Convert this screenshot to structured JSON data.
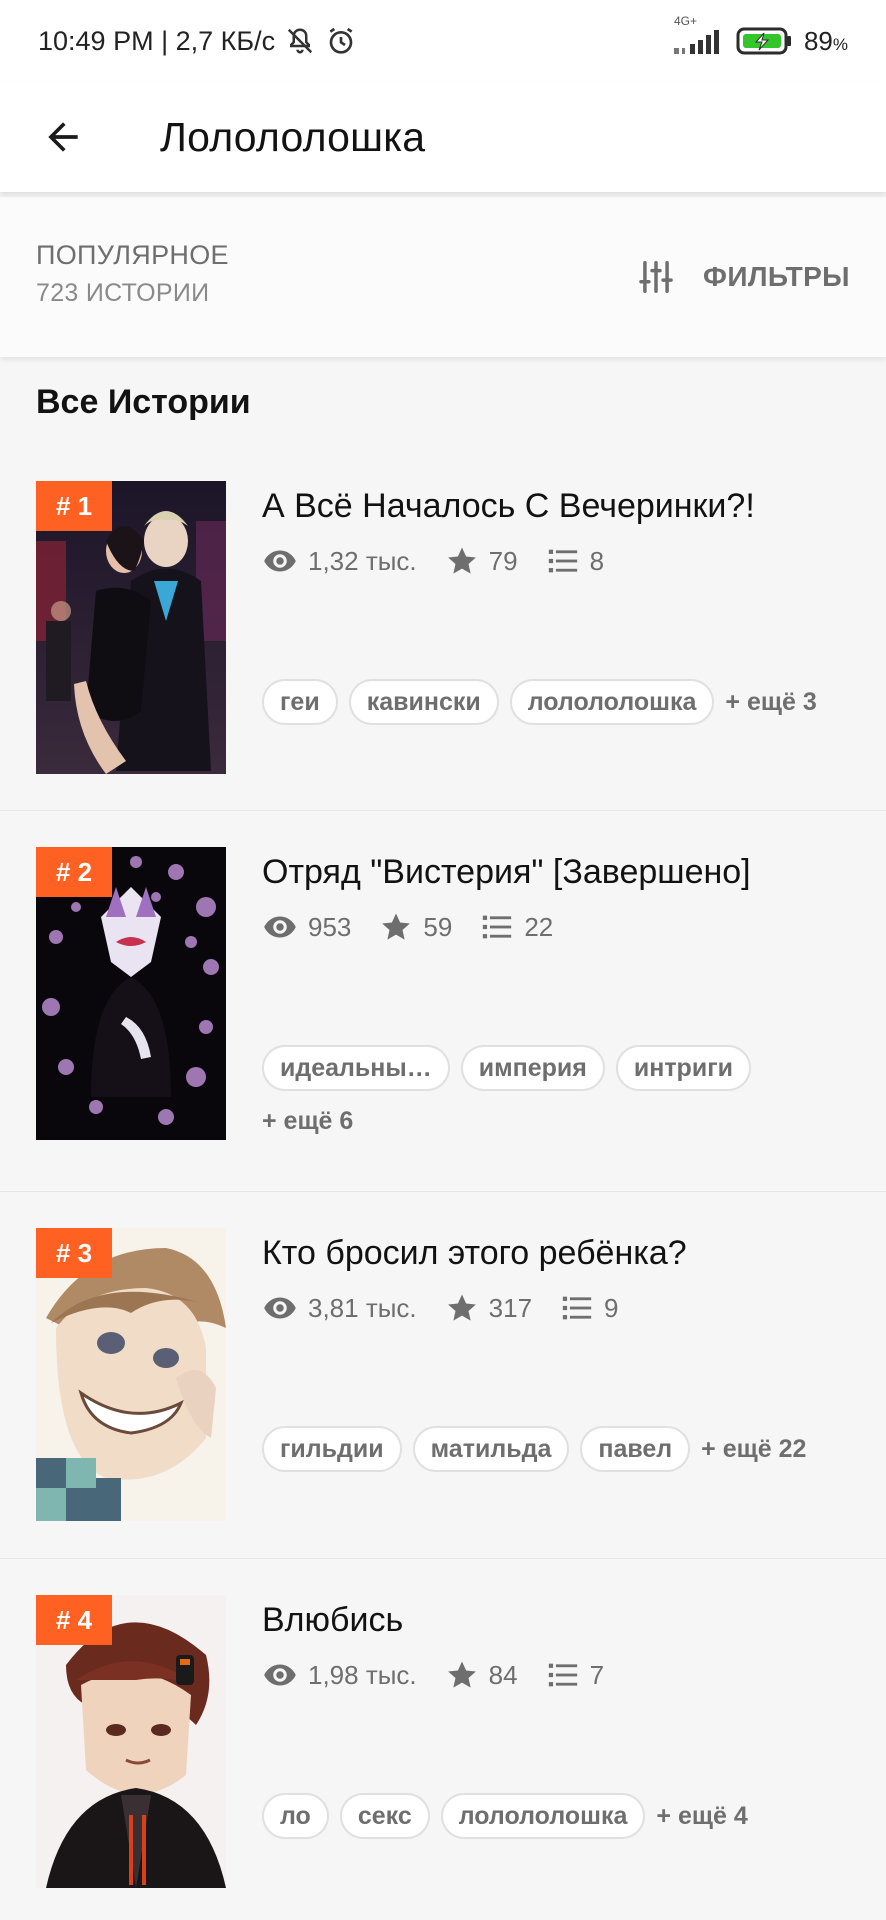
{
  "status_bar": {
    "time": "10:49 PM | 2,7 КБ/с",
    "network": "4G+",
    "battery_pct": "89",
    "battery_unit": "%"
  },
  "app_bar": {
    "title": "Лолололошка"
  },
  "sort_bar": {
    "sort_label": "ПОПУЛЯРНОЕ",
    "count_label": "723 ИСТОРИИ",
    "filter_label": "ФИЛЬТРЫ"
  },
  "section_title": "Все Истории",
  "colors": {
    "accent": "#ff6122",
    "text_primary": "#121212",
    "text_secondary": "#6e6e6e"
  },
  "stories": [
    {
      "rank": "# 1",
      "title": "А Всё Началось С Вечеринки?!",
      "reads": "1,32 тыс.",
      "votes": "79",
      "parts": "8",
      "tags": [
        "геи",
        "кавински",
        "лолололошка"
      ],
      "more": "+ ещё 3"
    },
    {
      "rank": "# 2",
      "title": "Отряд \"Вистерия\" [Завершено]",
      "reads": "953",
      "votes": "59",
      "parts": "22",
      "tags": [
        "идеальны…",
        "империя",
        "интриги"
      ],
      "more": "+ ещё 6"
    },
    {
      "rank": "# 3",
      "title": "Кто бросил этого ребёнка?",
      "reads": "3,81 тыс.",
      "votes": "317",
      "parts": "9",
      "tags": [
        "гильдии",
        "матильда",
        "павел"
      ],
      "more": "+ ещё 22"
    },
    {
      "rank": "# 4",
      "title": "Влюбись",
      "reads": "1,98 тыс.",
      "votes": "84",
      "parts": "7",
      "tags": [
        "ло",
        "секс",
        "лолололошка"
      ],
      "more": "+ ещё 4"
    }
  ]
}
